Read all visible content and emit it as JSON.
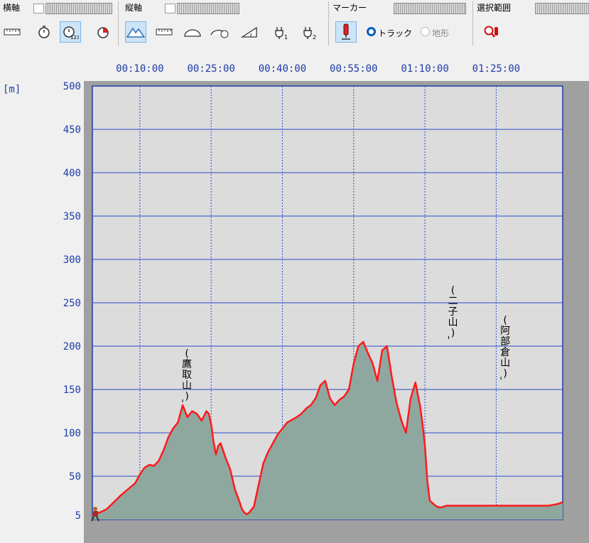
{
  "toolbar": {
    "horizontal_axis_label": "横軸",
    "vertical_axis_label": "縦軸",
    "marker_label": "マーカー",
    "selection_label": "選択範囲",
    "radio_track": "トラック",
    "radio_terrain": "地形",
    "selected_radio": "track",
    "accent_color": "#0078d7"
  },
  "chart_data": {
    "type": "area",
    "title": "",
    "xlabel": "",
    "ylabel": "[m]",
    "x_tick_labels": [
      "00:10:00",
      "00:25:00",
      "00:40:00",
      "00:55:00",
      "01:10:00",
      "01:25:00"
    ],
    "y_tick_labels": [
      "5",
      "50",
      "100",
      "150",
      "200",
      "250",
      "300",
      "350",
      "400",
      "450",
      "500"
    ],
    "ylim": [
      0,
      500
    ],
    "xlim_seconds": [
      0,
      5940
    ],
    "grid": true,
    "line_color": "#ff1a1a",
    "fill_color": "#8fa89f",
    "plot_background": "#dcdcdc",
    "series": [
      {
        "x_seconds": [
          0,
          90,
          180,
          270,
          360,
          450,
          540,
          600,
          660,
          720,
          780,
          840,
          900,
          960,
          1020,
          1080,
          1140,
          1200,
          1260,
          1320,
          1380,
          1440,
          1470,
          1500,
          1530,
          1560,
          1590,
          1620,
          1680,
          1740,
          1800,
          1860,
          1890,
          1920,
          1950,
          1980,
          2040,
          2100,
          2160,
          2220,
          2280,
          2340,
          2400,
          2460,
          2520,
          2580,
          2640,
          2700,
          2760,
          2820,
          2880,
          2940,
          3000,
          3060,
          3120,
          3180,
          3240,
          3300,
          3360,
          3420,
          3480,
          3540,
          3600,
          3660,
          3720,
          3780,
          3840,
          3900,
          3960,
          4020,
          4080,
          4140,
          4170,
          4200,
          4230,
          4260,
          4320,
          4350,
          4380,
          4410,
          4440,
          4470,
          4500,
          4560,
          4620,
          4680,
          4740,
          4800,
          4860,
          4920,
          4980,
          5040,
          5100,
          5160,
          5220,
          5280,
          5340,
          5400,
          5460,
          5520,
          5580,
          5640,
          5700,
          5760,
          5820,
          5880,
          5940
        ],
        "y": [
          5,
          8,
          12,
          20,
          28,
          35,
          42,
          52,
          60,
          63,
          62,
          68,
          80,
          95,
          105,
          112,
          132,
          118,
          125,
          122,
          114,
          125,
          122,
          110,
          90,
          75,
          85,
          88,
          72,
          58,
          35,
          20,
          12,
          8,
          6,
          8,
          15,
          40,
          65,
          78,
          88,
          98,
          105,
          112,
          115,
          118,
          122,
          128,
          132,
          140,
          155,
          160,
          140,
          132,
          138,
          142,
          150,
          180,
          200,
          205,
          192,
          180,
          160,
          195,
          200,
          165,
          135,
          115,
          100,
          140,
          158,
          130,
          110,
          85,
          45,
          22,
          17,
          15,
          14,
          14,
          15,
          16,
          16,
          16,
          16,
          16,
          16,
          16,
          16,
          16,
          16,
          16,
          16,
          16,
          16,
          16,
          16,
          16,
          16,
          16,
          16,
          16,
          16,
          16,
          17,
          18,
          20
        ]
      }
    ],
    "annotations": [
      {
        "label": "(鷹取山)",
        "x_seconds": 1140,
        "y": 132
      },
      {
        "label": "(二子山)",
        "x_seconds": 4500,
        "y": 205
      },
      {
        "label": "(阿部倉山)",
        "x_seconds": 5160,
        "y": 158
      }
    ]
  }
}
